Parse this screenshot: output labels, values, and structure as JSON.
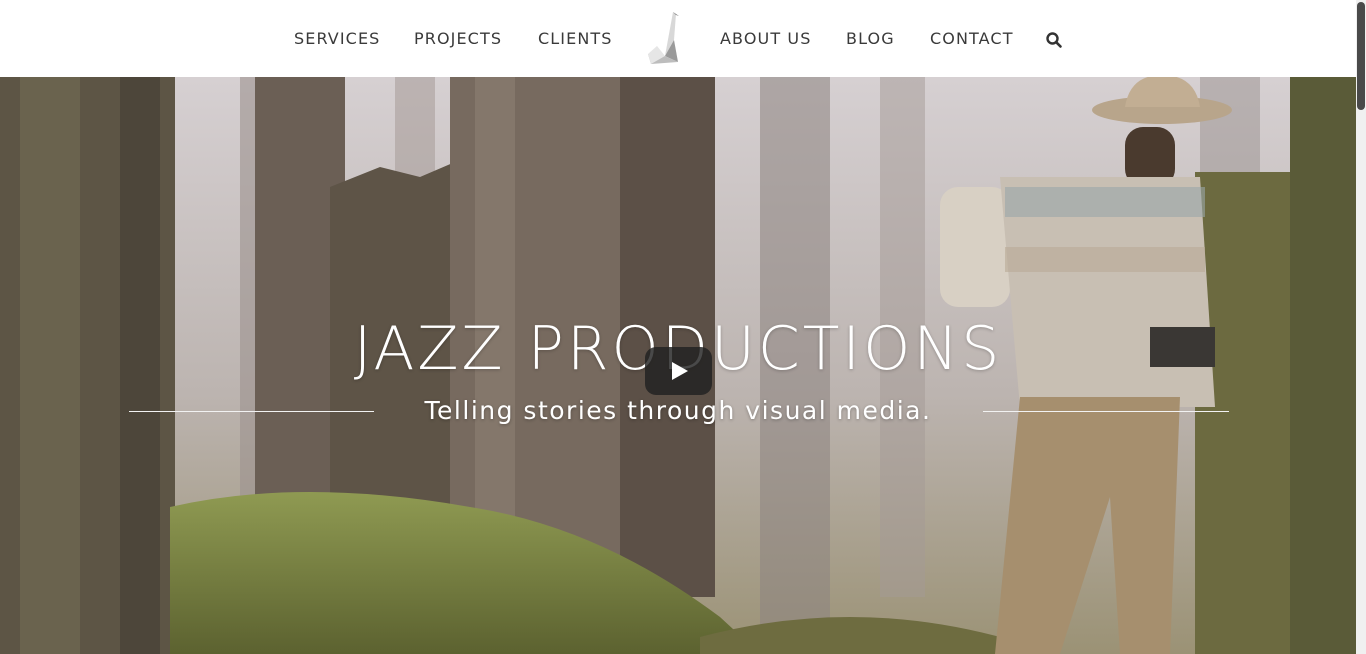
{
  "nav": {
    "items": [
      {
        "label": "SERVICES"
      },
      {
        "label": "PROJECTS"
      },
      {
        "label": "CLIENTS"
      },
      {
        "label": "ABOUT US"
      },
      {
        "label": "BLOG"
      },
      {
        "label": "CONTACT"
      }
    ],
    "search_icon": "search-icon",
    "logo_icon": "origami-crane-logo"
  },
  "hero": {
    "title": "JAZZ PRODUCTIONS",
    "subtitle": "Telling stories through visual media.",
    "play_icon": "play-icon"
  },
  "colors": {
    "nav_text": "#3a3a3a",
    "header_bg": "#ffffff",
    "hero_text": "#ffffff"
  }
}
